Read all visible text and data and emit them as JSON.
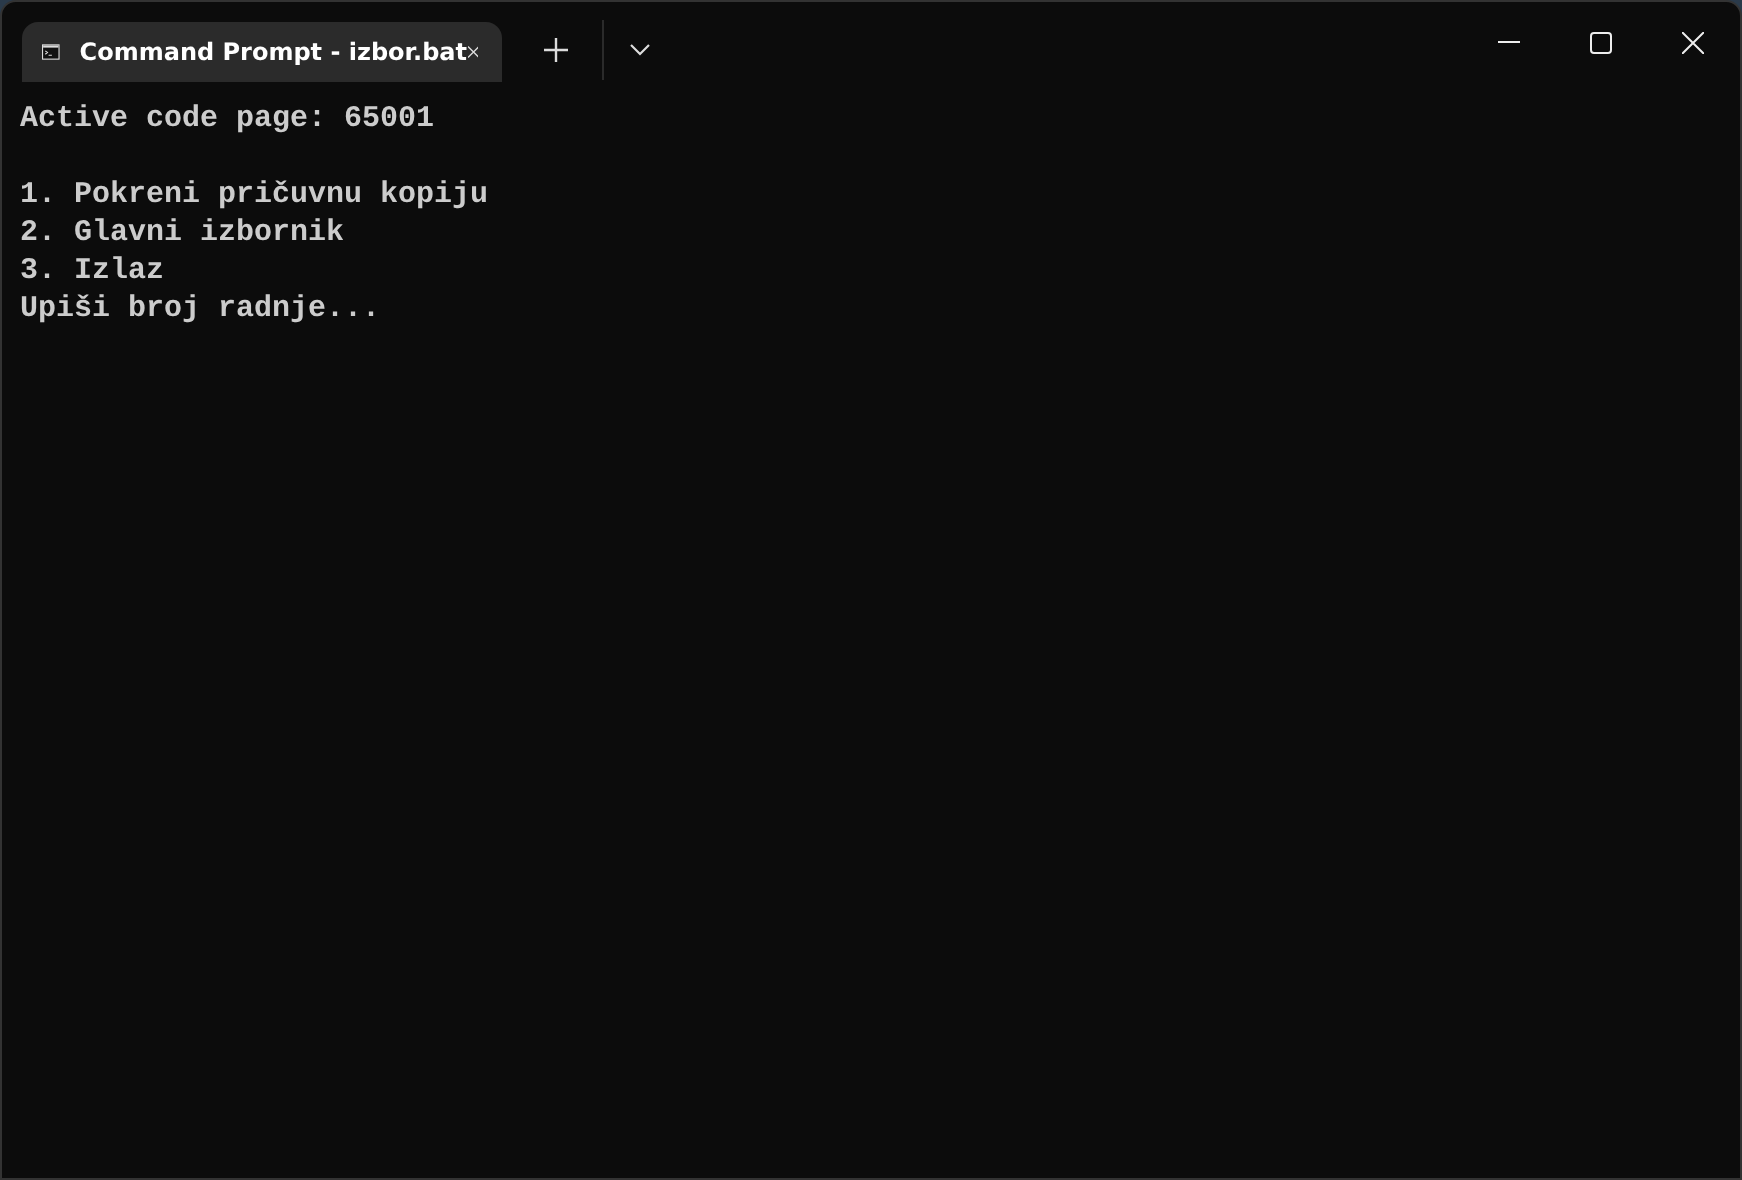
{
  "tab": {
    "title": "Command Prompt - izbor.bat",
    "selected": true
  },
  "terminal": {
    "header": "Active code page: 65001",
    "menu": [
      "1. Pokreni pričuvnu kopiju",
      "2. Glavni izbornik",
      "3. Izlaz"
    ],
    "prompt": "Upiši broj radnje..."
  }
}
